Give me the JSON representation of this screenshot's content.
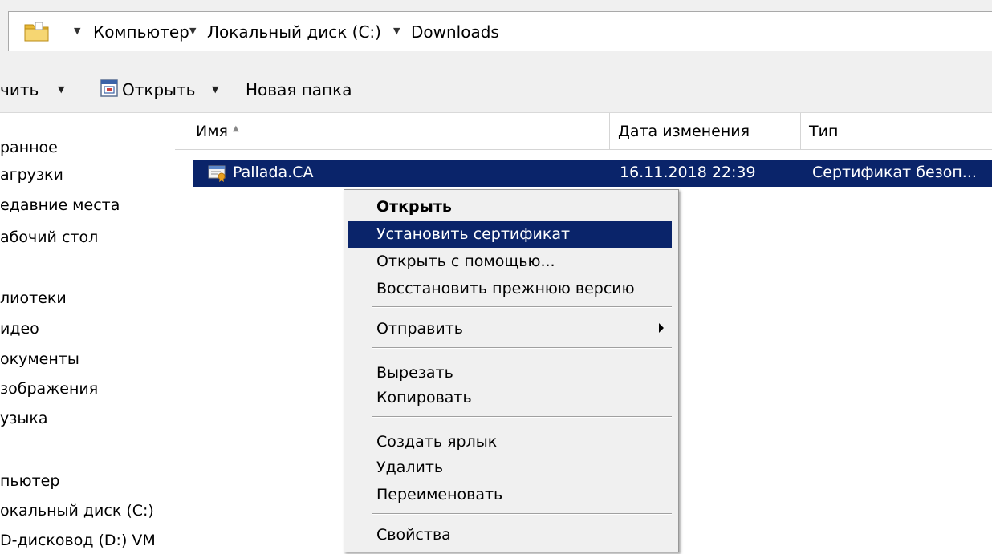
{
  "address_bar": {
    "crumbs": [
      "Компьютер",
      "Локальный диск (C:)",
      "Downloads"
    ]
  },
  "toolbar": {
    "organize_label": "чить",
    "open_label": "Открыть",
    "new_folder_label": "Новая папка"
  },
  "nav": {
    "items": [
      "ранное",
      "агрузки",
      "едавние места",
      "абочий стол",
      "лиотеки",
      "идео",
      "окументы",
      "зображения",
      "узыка",
      "пьютер",
      "окальный диск (C:)",
      "D-дисковод (D:) VM"
    ]
  },
  "columns": {
    "name": "Имя",
    "date": "Дата изменения",
    "type": "Тип"
  },
  "file": {
    "name": "Pallada.CA",
    "date": "16.11.2018 22:39",
    "type": "Сертификат безоп..."
  },
  "context_menu": {
    "open": "Открыть",
    "install_cert": "Установить сертификат",
    "open_with": "Открыть с помощью...",
    "restore": "Восстановить прежнюю версию",
    "send_to": "Отправить",
    "cut": "Вырезать",
    "copy": "Копировать",
    "create_shortcut": "Создать ярлык",
    "delete": "Удалить",
    "rename": "Переименовать",
    "properties": "Свойства"
  },
  "colors": {
    "selection": "#0a246a",
    "menu_bg": "#f0f0f0",
    "toolbar_bg": "#f0f0f0"
  },
  "icons": {
    "folder": "folder-icon",
    "open": "open-file-icon",
    "certificate": "certificate-icon",
    "submenu": "submenu-arrow-icon"
  }
}
